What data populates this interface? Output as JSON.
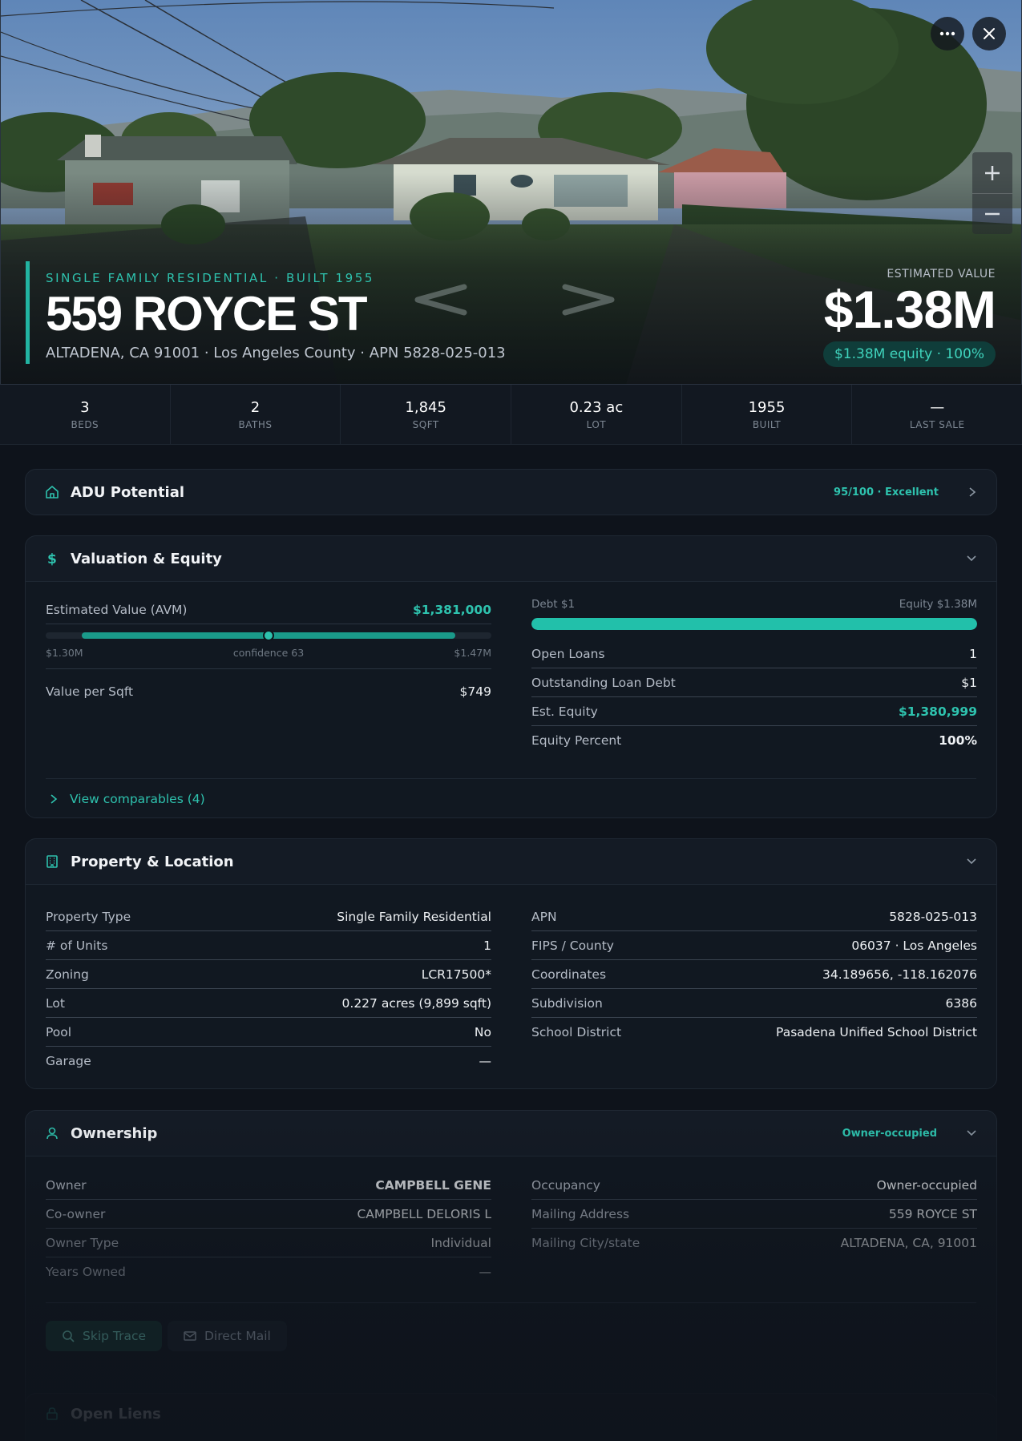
{
  "hero": {
    "eyebrow": "SINGLE FAMILY RESIDENTIAL · BUILT 1955",
    "address": "559 ROYCE ST",
    "subaddress": "ALTADENA, CA 91001 · Los Angeles County · APN 5828-025-013",
    "estimated_value_label": "ESTIMATED VALUE",
    "estimated_value": "$1.38M",
    "equity_badge": "$1.38M equity · 100%",
    "icons": [
      "more-icon",
      "close-icon",
      "zoom-in-icon",
      "zoom-out-icon",
      "chevron-left-icon",
      "chevron-right-icon"
    ]
  },
  "stats": [
    {
      "value": "3",
      "label": "BEDS"
    },
    {
      "value": "2",
      "label": "BATHS"
    },
    {
      "value": "1,845",
      "label": "SQFT"
    },
    {
      "value": "0.23 ac",
      "label": "LOT"
    },
    {
      "value": "1955",
      "label": "BUILT"
    },
    {
      "value": "—",
      "label": "LAST SALE"
    }
  ],
  "adu": {
    "title": "ADU Potential",
    "score": "95/100 · Excellent"
  },
  "valuation": {
    "title": "Valuation & Equity",
    "avm_label": "Estimated Value (AVM)",
    "avm_value": "$1,381,000",
    "range_low": "$1.30M",
    "confidence": "confidence 63",
    "range_high": "$1.47M",
    "value_per_sqft_label": "Value per Sqft",
    "value_per_sqft": "$749",
    "debt_label": "Debt $1",
    "equity_label": "Equity $1.38M",
    "equity_fraction": 1.0,
    "rows": [
      {
        "k": "Open Loans",
        "v": "1"
      },
      {
        "k": "Outstanding Loan Debt",
        "v": "$1"
      },
      {
        "k": "Est. Equity",
        "v": "$1,380,999"
      },
      {
        "k": "Equity Percent",
        "v": "100%"
      }
    ],
    "comparables_link": "View comparables (4)"
  },
  "property": {
    "title": "Property & Location",
    "left": [
      {
        "k": "Property Type",
        "v": "Single Family Residential"
      },
      {
        "k": "# of Units",
        "v": "1"
      },
      {
        "k": "Zoning",
        "v": "LCR17500*"
      },
      {
        "k": "Lot",
        "v": "0.227 acres (9,899 sqft)"
      },
      {
        "k": "Pool",
        "v": "No"
      },
      {
        "k": "Garage",
        "v": "—"
      }
    ],
    "right": [
      {
        "k": "APN",
        "v": "5828-025-013"
      },
      {
        "k": "FIPS / County",
        "v": "06037 · Los Angeles"
      },
      {
        "k": "Coordinates",
        "v": "34.189656, -118.162076"
      },
      {
        "k": "Subdivision",
        "v": "6386"
      },
      {
        "k": "School District",
        "v": "Pasadena Unified School District"
      }
    ]
  },
  "ownership": {
    "title": "Ownership",
    "tag": "Owner-occupied",
    "left": [
      {
        "k": "Owner",
        "v": "CAMPBELL GENE"
      },
      {
        "k": "Co-owner",
        "v": "CAMPBELL DELORIS L"
      },
      {
        "k": "Owner Type",
        "v": "Individual"
      },
      {
        "k": "Years Owned",
        "v": "—"
      }
    ],
    "right": [
      {
        "k": "Occupancy",
        "v": "Owner-occupied"
      },
      {
        "k": "Mailing Address",
        "v": "559 ROYCE ST"
      },
      {
        "k": "Mailing City/state",
        "v": "ALTADENA, CA, 91001"
      }
    ],
    "skip_trace": "Skip Trace",
    "direct_mail": "Direct Mail"
  },
  "liens": {
    "title": "Open Liens"
  },
  "colors": {
    "accent": "#2ec2ae",
    "background": "#0e131b",
    "card": "#141b25"
  }
}
